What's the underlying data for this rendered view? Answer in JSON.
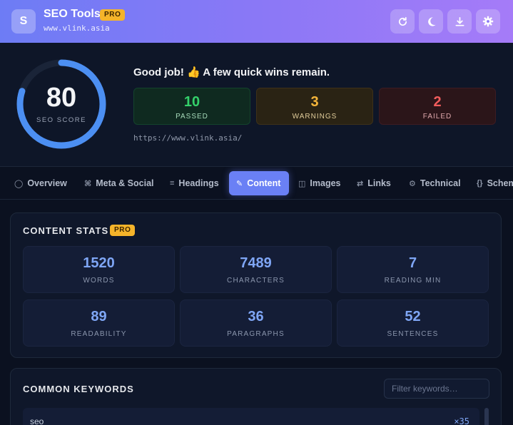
{
  "header": {
    "logo_letter": "S",
    "title": "SEO Tools",
    "pro_label": "PRO",
    "url": "www.vlink.asia",
    "buttons": [
      {
        "name": "refresh-button",
        "icon": "refresh-icon"
      },
      {
        "name": "theme-toggle-button",
        "icon": "moon-icon"
      },
      {
        "name": "download-button",
        "icon": "download-icon"
      },
      {
        "name": "settings-button",
        "icon": "gear-icon"
      }
    ]
  },
  "score": {
    "value": "80",
    "label": "SEO SCORE",
    "fraction": 0.8,
    "verdict": "Good job! 👍 A few quick wins remain.",
    "passed": {
      "count": "10",
      "label": "PASSED"
    },
    "warnings": {
      "count": "3",
      "label": "WARNINGS"
    },
    "failed": {
      "count": "2",
      "label": "FAILED"
    },
    "page_url": "https://www.vlink.asia/"
  },
  "tabs": [
    {
      "label": "Overview",
      "icon": "◯",
      "active": false
    },
    {
      "label": "Meta & Social",
      "icon": "⌘",
      "active": false
    },
    {
      "label": "Headings",
      "icon": "≡",
      "active": false
    },
    {
      "label": "Content",
      "icon": "✎",
      "active": true
    },
    {
      "label": "Images",
      "icon": "◫",
      "active": false
    },
    {
      "label": "Links",
      "icon": "⇄",
      "active": false
    },
    {
      "label": "Technical",
      "icon": "⚙",
      "active": false
    },
    {
      "label": "Schema",
      "icon": "{}",
      "active": false
    }
  ],
  "content_stats": {
    "title": "CONTENT STATS",
    "pro_label": "PRO",
    "items": [
      {
        "value": "1520",
        "label": "WORDS"
      },
      {
        "value": "7489",
        "label": "CHARACTERS"
      },
      {
        "value": "7",
        "label": "READING MIN"
      },
      {
        "value": "89",
        "label": "READABILITY"
      },
      {
        "value": "36",
        "label": "PARAGRAPHS"
      },
      {
        "value": "52",
        "label": "SENTENCES"
      }
    ]
  },
  "keywords": {
    "title": "COMMON KEYWORDS",
    "filter_placeholder": "Filter keywords…",
    "rows": [
      {
        "word": "seo",
        "count": "×35"
      }
    ]
  },
  "colors": {
    "accent": "#6a80f5",
    "passed": "#34d06a",
    "warning": "#f5b53a",
    "failed": "#f05c5c",
    "score_ring": "#4c8ff2"
  }
}
